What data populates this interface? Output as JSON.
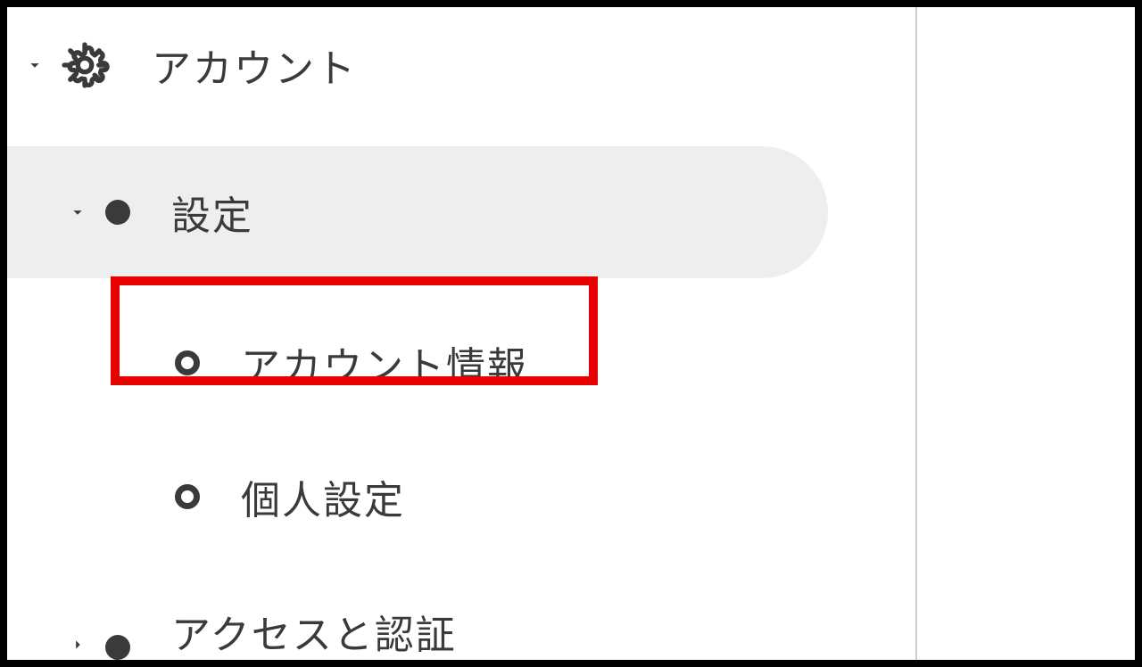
{
  "tree": {
    "root": {
      "label": "アカウント",
      "expanded": true
    },
    "settings": {
      "label": "設定",
      "expanded": true,
      "selected": true
    },
    "account_info": {
      "label": "アカウント情報",
      "highlighted": true
    },
    "personal_settings": {
      "label": "個人設定"
    },
    "access_auth": {
      "label": "アクセスと認証",
      "expanded": false
    }
  }
}
